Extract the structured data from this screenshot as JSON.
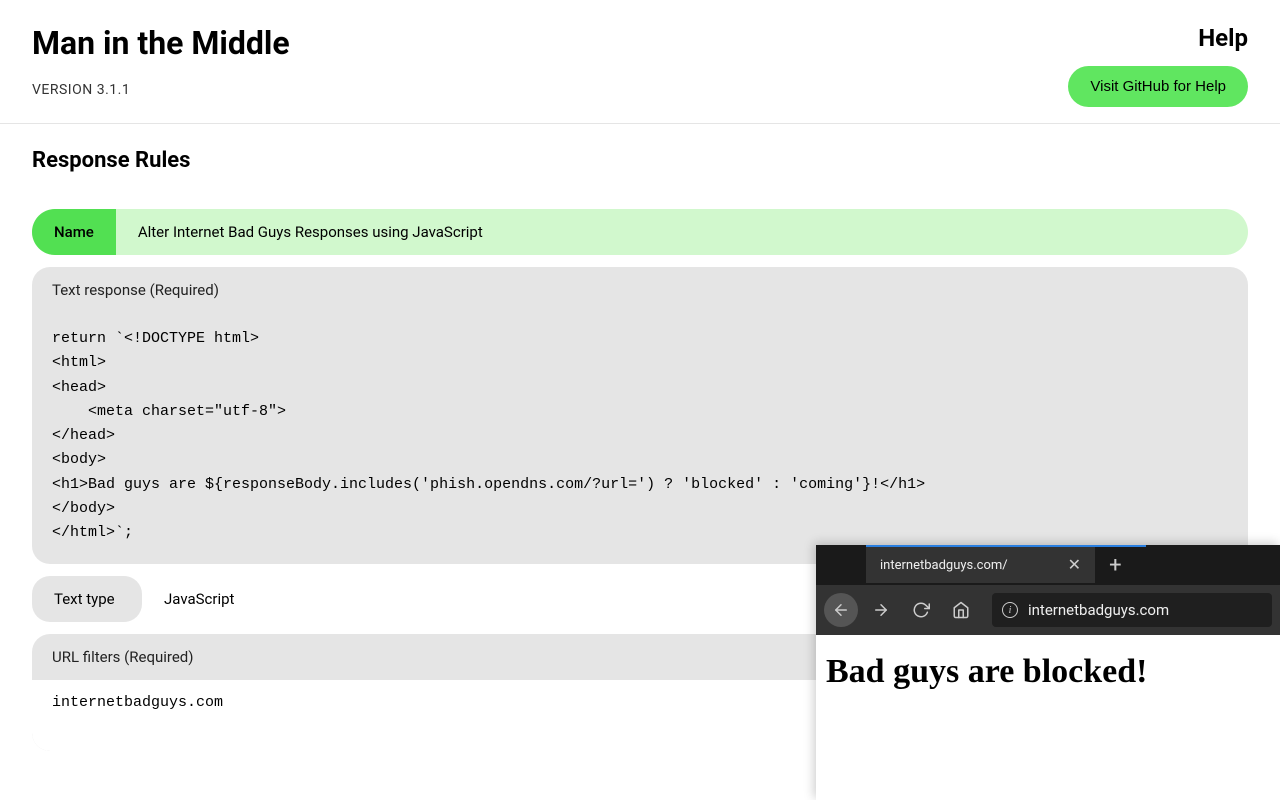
{
  "header": {
    "title": "Man in the Middle",
    "version": "VERSION 3.1.1",
    "help": "Help",
    "github_btn": "Visit GitHub for Help"
  },
  "section_title": "Response Rules",
  "rule": {
    "name_label": "Name",
    "name_value": "Alter Internet Bad Guys Responses using JavaScript",
    "text_response_label": "Text response (Required)",
    "code": "return `<!DOCTYPE html>\n<html>\n<head>\n    <meta charset=\"utf-8\">\n</head>\n<body>\n<h1>Bad guys are ${responseBody.includes('phish.opendns.com/?url=') ? 'blocked' : 'coming'}!</h1>\n</body>\n</html>`;",
    "text_type_label": "Text type",
    "text_type_value": "JavaScript",
    "url_filters_label": "URL filters (Required)",
    "url_filters_value": "internetbadguys.com"
  },
  "browser": {
    "tab_title": "internetbadguys.com/",
    "url": "internetbadguys.com",
    "page_heading": "Bad guys are blocked!"
  }
}
